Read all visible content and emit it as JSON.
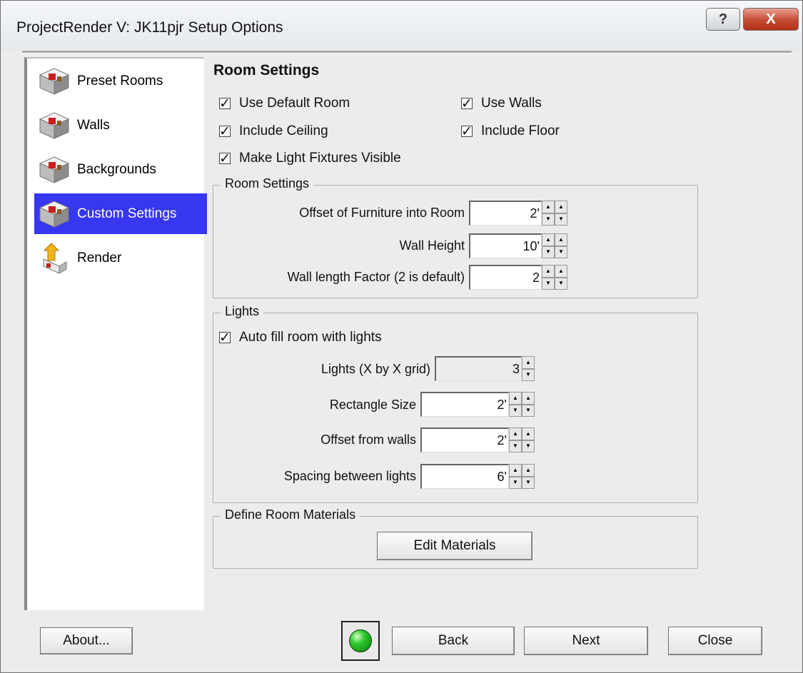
{
  "window": {
    "title": "ProjectRender V:  JK11pjr Setup Options"
  },
  "titlebar": {
    "help_label": "?",
    "close_label": "X"
  },
  "sidebar": {
    "items": [
      {
        "label": "Preset Rooms",
        "icon": "room-icon",
        "active": false
      },
      {
        "label": "Walls",
        "icon": "room-icon",
        "active": false
      },
      {
        "label": "Backgrounds",
        "icon": "room-icon",
        "active": false
      },
      {
        "label": "Custom Settings",
        "icon": "room-icon",
        "active": true
      },
      {
        "label": "Render",
        "icon": "render-icon",
        "active": false
      }
    ]
  },
  "main": {
    "heading": "Room Settings",
    "checkboxes": {
      "use_default_room": "Use Default Room",
      "use_walls": "Use Walls",
      "include_ceiling": "Include Ceiling",
      "include_floor": "Include Floor",
      "make_light_fixtures_visible": "Make Light Fixtures Visible"
    },
    "checkmark": "✓",
    "room_settings_group": {
      "legend": "Room Settings",
      "offset_label": "Offset of Furniture into Room",
      "offset_value": "2'",
      "wall_height_label": "Wall Height",
      "wall_height_value": "10'",
      "wall_length_label": "Wall length Factor (2 is default)",
      "wall_length_value": "2"
    },
    "lights_group": {
      "legend": "Lights",
      "auto_fill_label": "Auto fill room with lights",
      "grid_label": "Lights (X by X grid)",
      "grid_value": "3",
      "rect_size_label": "Rectangle Size",
      "rect_size_value": "2'",
      "offset_walls_label": "Offset from walls",
      "offset_walls_value": "2'",
      "spacing_label": "Spacing between lights",
      "spacing_value": "6'"
    },
    "materials_group": {
      "legend": "Define Room Materials",
      "edit_button": "Edit Materials"
    }
  },
  "footer": {
    "about": "About...",
    "back": "Back",
    "next": "Next",
    "close": "Close"
  },
  "colors": {
    "selection": "#3737f2",
    "status_light": "#2ecb2e"
  }
}
